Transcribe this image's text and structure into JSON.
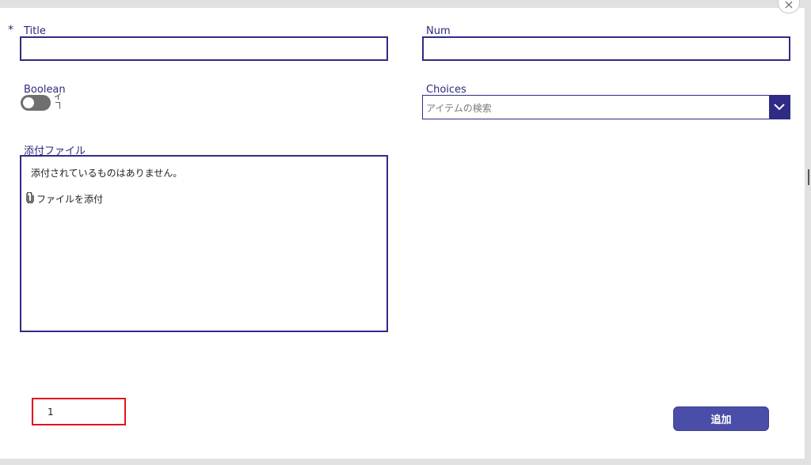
{
  "form": {
    "title_required_mark": "*",
    "title_label": "Title",
    "title_value": "",
    "num_label": "Num",
    "num_value": "",
    "boolean_label": "Boolean",
    "boolean_state_text": "イ\nヿ",
    "choices_label": "Choices",
    "choices_placeholder": "アイテムの検索",
    "attachments_label": "添付ファイル",
    "attachments_empty_text": "添付されているものはありません。",
    "attach_file_label": "ファイルを添付"
  },
  "counter": {
    "value": "1"
  },
  "actions": {
    "submit_label": "追加"
  },
  "icons": {
    "close": "close-icon",
    "chevron": "chevron-down-icon",
    "paperclip": "paperclip-icon"
  },
  "colors": {
    "accent": "#2f2b86",
    "button": "#4b4ea8",
    "highlight_border": "#e3141b"
  }
}
